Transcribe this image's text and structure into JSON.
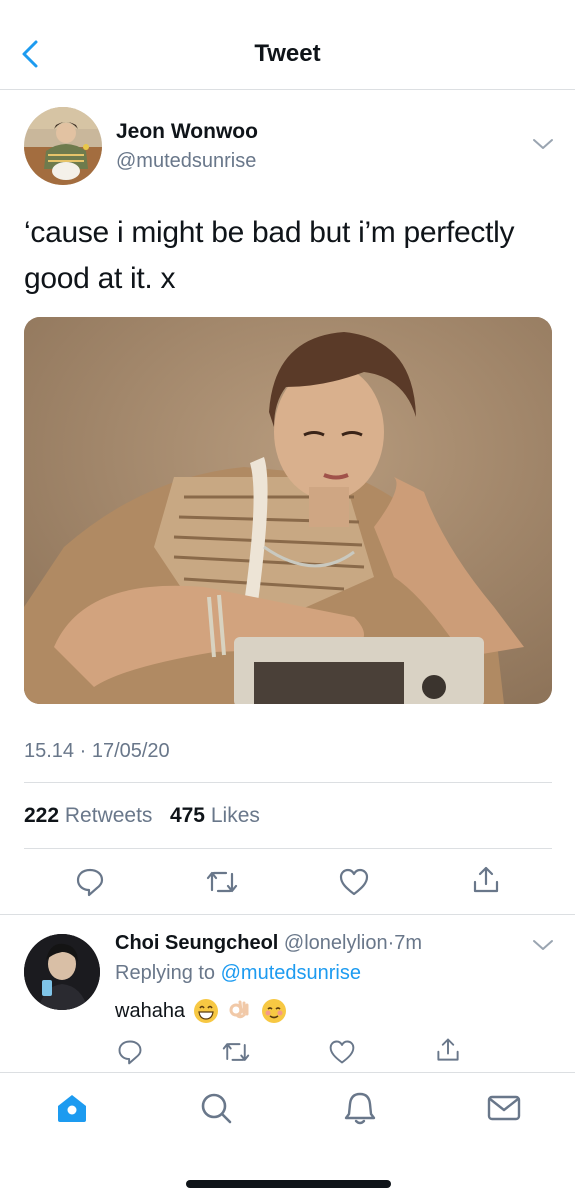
{
  "header": {
    "title": "Tweet",
    "back_icon": "chevron-left-icon"
  },
  "tweet": {
    "author_name": "Jeon Wonwoo",
    "author_handle": "@mutedsunrise",
    "text": "‘cause i might be bad but i’m perfectly good at it. x",
    "timestamp": "15.14 · 17/05/20",
    "retweet_count": "222",
    "retweet_label": "Retweets",
    "like_count": "475",
    "like_label": "Likes",
    "actions": [
      "reply-icon",
      "retweet-icon",
      "like-icon",
      "share-icon"
    ]
  },
  "reply": {
    "author_name": "Choi Seungcheol",
    "author_handle": "@lonelylion",
    "separator": "·",
    "time": "7m",
    "replying_prefix": "Replying to",
    "replying_handle": "@mutedsunrise",
    "text": "wahaha",
    "emojis": [
      "grinning-face-icon",
      "ok-hand-icon",
      "relieved-face-icon"
    ]
  },
  "tabbar": {
    "items": [
      "home-icon",
      "search-icon",
      "notifications-icon",
      "messages-icon"
    ],
    "active": "home-icon"
  },
  "colors": {
    "accent": "#1d9bf0",
    "muted": "#69778a",
    "divider": "#dcdfe2"
  }
}
